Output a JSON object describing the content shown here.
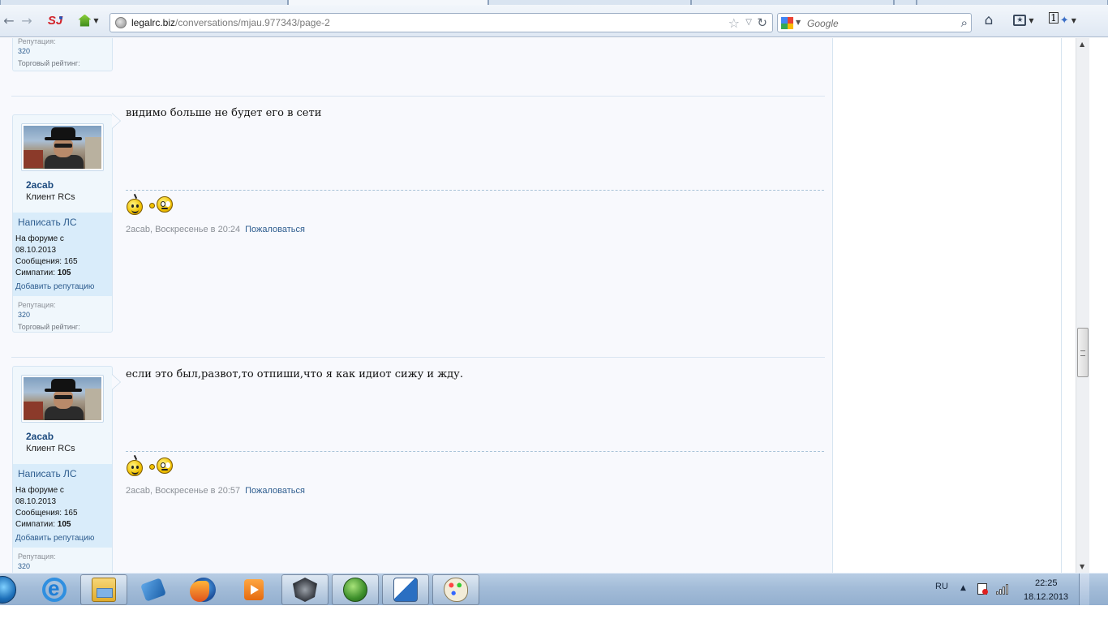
{
  "browser": {
    "url_host": "legalrc.biz",
    "url_path": "/conversations/mjau.977343/page-2",
    "search_placeholder": "Google",
    "sj_label": "SJ",
    "ext_label": "1"
  },
  "posts": [
    {
      "id": "prev",
      "partial": true,
      "reputation_label": "Репутация:",
      "reputation_value": "320",
      "trade_label": "Торговый рейтинг:"
    },
    {
      "id": "post1",
      "username": "2acab",
      "user_title": "Клиент RCs",
      "pm_link": "Написать ЛС",
      "joined_label": "На форуме с",
      "joined_date": "08.10.2013",
      "messages_label": "Сообщения:",
      "messages_value": "165",
      "likes_label": "Симпатии:",
      "likes_value": "105",
      "add_rep": "Добавить репутацию",
      "reputation_label": "Репутация:",
      "reputation_value": "320",
      "trade_label": "Торговый рейтинг:",
      "text": "видимо больше не будет его в сети",
      "meta": "2acab, Воскресенье в 20:24",
      "report": "Пожаловаться"
    },
    {
      "id": "post2",
      "username": "2acab",
      "user_title": "Клиент RCs",
      "pm_link": "Написать ЛС",
      "joined_label": "На форуме с",
      "joined_date": "08.10.2013",
      "messages_label": "Сообщения:",
      "messages_value": "165",
      "likes_label": "Симпатии:",
      "likes_value": "105",
      "add_rep": "Добавить репутацию",
      "reputation_label": "Репутация:",
      "reputation_value": "320",
      "text": "если это был,развот,то отпиши,что я как идиот сижу и жду.",
      "meta": "2acab, Воскресенье в 20:57",
      "report": "Пожаловаться"
    }
  ],
  "taskbar": {
    "apps": [
      "internet-explorer",
      "windows-explorer",
      "tool",
      "firefox",
      "media-player",
      "wolf-app",
      "globe-app",
      "shield-app",
      "paint"
    ],
    "language": "RU",
    "time": "22:25",
    "date": "18.12.2013"
  }
}
